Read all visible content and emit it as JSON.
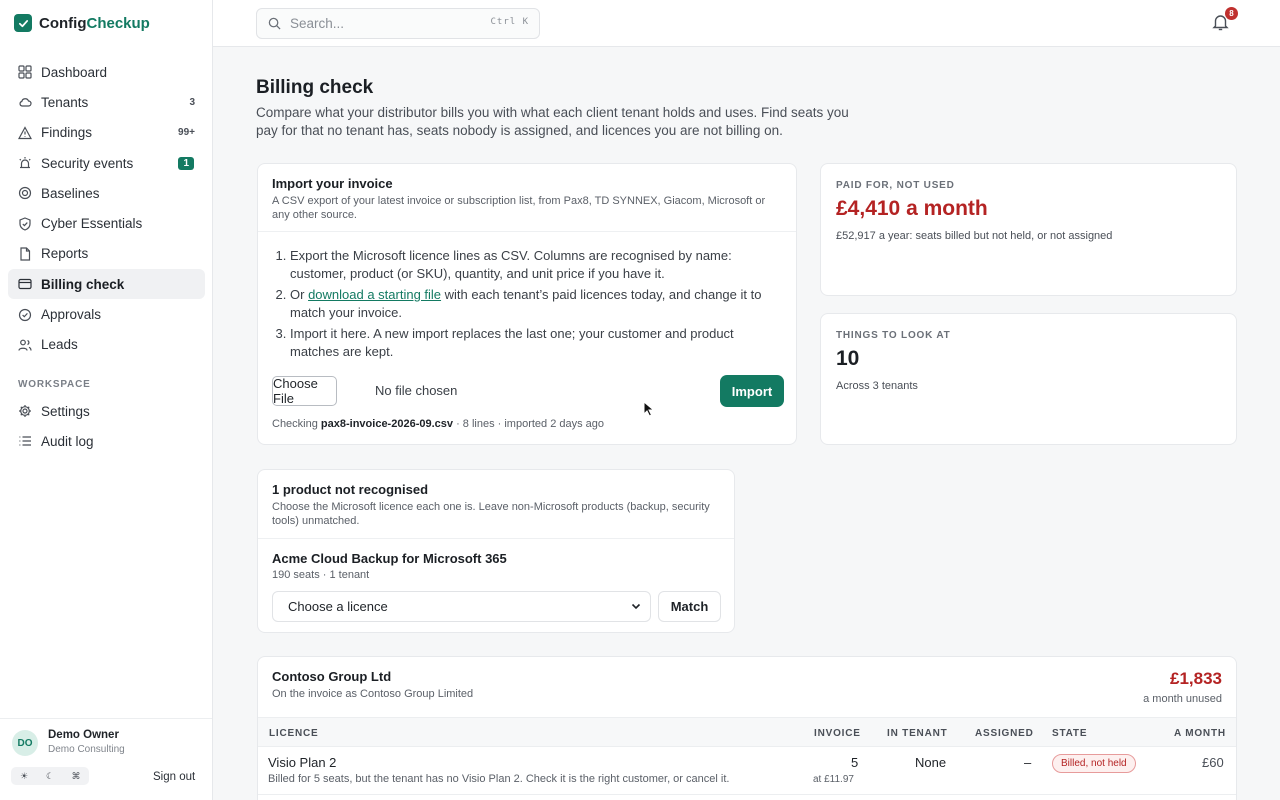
{
  "app": {
    "name_part1": "Config",
    "name_part2": "Checkup"
  },
  "sidebar": {
    "items": [
      {
        "label": "Dashboard",
        "icon": "grid-icon",
        "badge": ""
      },
      {
        "label": "Tenants",
        "icon": "cloud-icon",
        "badge": "3"
      },
      {
        "label": "Findings",
        "icon": "warning-icon",
        "badge": "99+"
      },
      {
        "label": "Security events",
        "icon": "alarm-icon",
        "badge": "1"
      },
      {
        "label": "Baselines",
        "icon": "target-icon",
        "badge": ""
      },
      {
        "label": "Cyber Essentials",
        "icon": "shield-check-icon",
        "badge": ""
      },
      {
        "label": "Reports",
        "icon": "document-icon",
        "badge": ""
      },
      {
        "label": "Billing check",
        "icon": "card-icon",
        "badge": ""
      },
      {
        "label": "Approvals",
        "icon": "check-circle-icon",
        "badge": ""
      },
      {
        "label": "Leads",
        "icon": "users-icon",
        "badge": ""
      }
    ],
    "workspace_label": "WORKSPACE",
    "workspace_items": [
      {
        "label": "Settings",
        "icon": "gear-icon"
      },
      {
        "label": "Audit log",
        "icon": "list-icon"
      }
    ],
    "user": {
      "initials": "DO",
      "name": "Demo Owner",
      "org": "Demo Consulting",
      "signout": "Sign out",
      "theme_options": [
        "☀",
        "☾",
        "⌘"
      ]
    }
  },
  "topbar": {
    "search_placeholder": "Search...",
    "shortcut": "Ctrl K",
    "notifications": "8"
  },
  "page": {
    "title": "Billing check",
    "description": "Compare what your distributor bills you with what each client tenant holds and uses. Find seats you pay for that no tenant has, seats nobody is assigned, and licences you are not billing on."
  },
  "import": {
    "title": "Import your invoice",
    "subtitle": "A CSV export of your latest invoice or subscription list, from Pax8, TD SYNNEX, Giacom, Microsoft or any other source.",
    "step1": "Export the Microsoft licence lines as CSV. Columns are recognised by name: customer, product (or SKU), quantity, and unit price if you have it.",
    "step2_before": "Or ",
    "step2_link": "download a starting file",
    "step2_after": " with each tenant’s paid licences today, and change it to match your invoice.",
    "step3": "Import it here. A new import replaces the last one; your customer and product matches are kept.",
    "choose_file": "Choose File",
    "file_state": "No file chosen",
    "import_button": "Import",
    "checking_prefix": "Checking ",
    "checking_file": "pax8-invoice-2026-09.csv",
    "checking_suffix": " · 8 lines · imported 2 days ago"
  },
  "stats": {
    "unused": {
      "label": "PAID FOR, NOT USED",
      "value": "£4,410 a month",
      "note": "£52,917 a year: seats billed but not held, or not assigned"
    },
    "look": {
      "label": "THINGS TO LOOK AT",
      "value": "10",
      "note": "Across 3 tenants"
    }
  },
  "unrecognised": {
    "title": "1 product not recognised",
    "subtitle": "Choose the Microsoft licence each one is. Leave non-Microsoft products (backup, security tools) unmatched.",
    "product": "Acme Cloud Backup for Microsoft 365",
    "meta": "190 seats · 1 tenant",
    "select_value": "Choose a licence",
    "match_button": "Match"
  },
  "tenant": {
    "name": "Contoso Group Ltd",
    "subtitle": "On the invoice as Contoso Group Limited",
    "amount": "£1,833",
    "amount_note": "a month unused",
    "columns": [
      "LICENCE",
      "INVOICE",
      "IN TENANT",
      "ASSIGNED",
      "STATE",
      "A MONTH"
    ],
    "rows": [
      {
        "licence": "Visio Plan 2",
        "detail": "Billed for 5 seats, but the tenant has no Visio Plan 2. Check it is the right customer, or cancel it.",
        "invoice": "5",
        "unit_price": "at £11.97",
        "in_tenant": "None",
        "assigned": "–",
        "state": "Billed, not held",
        "a_month": "£60"
      }
    ]
  },
  "colors": {
    "accent": "#137a62",
    "danger": "#b42323"
  }
}
